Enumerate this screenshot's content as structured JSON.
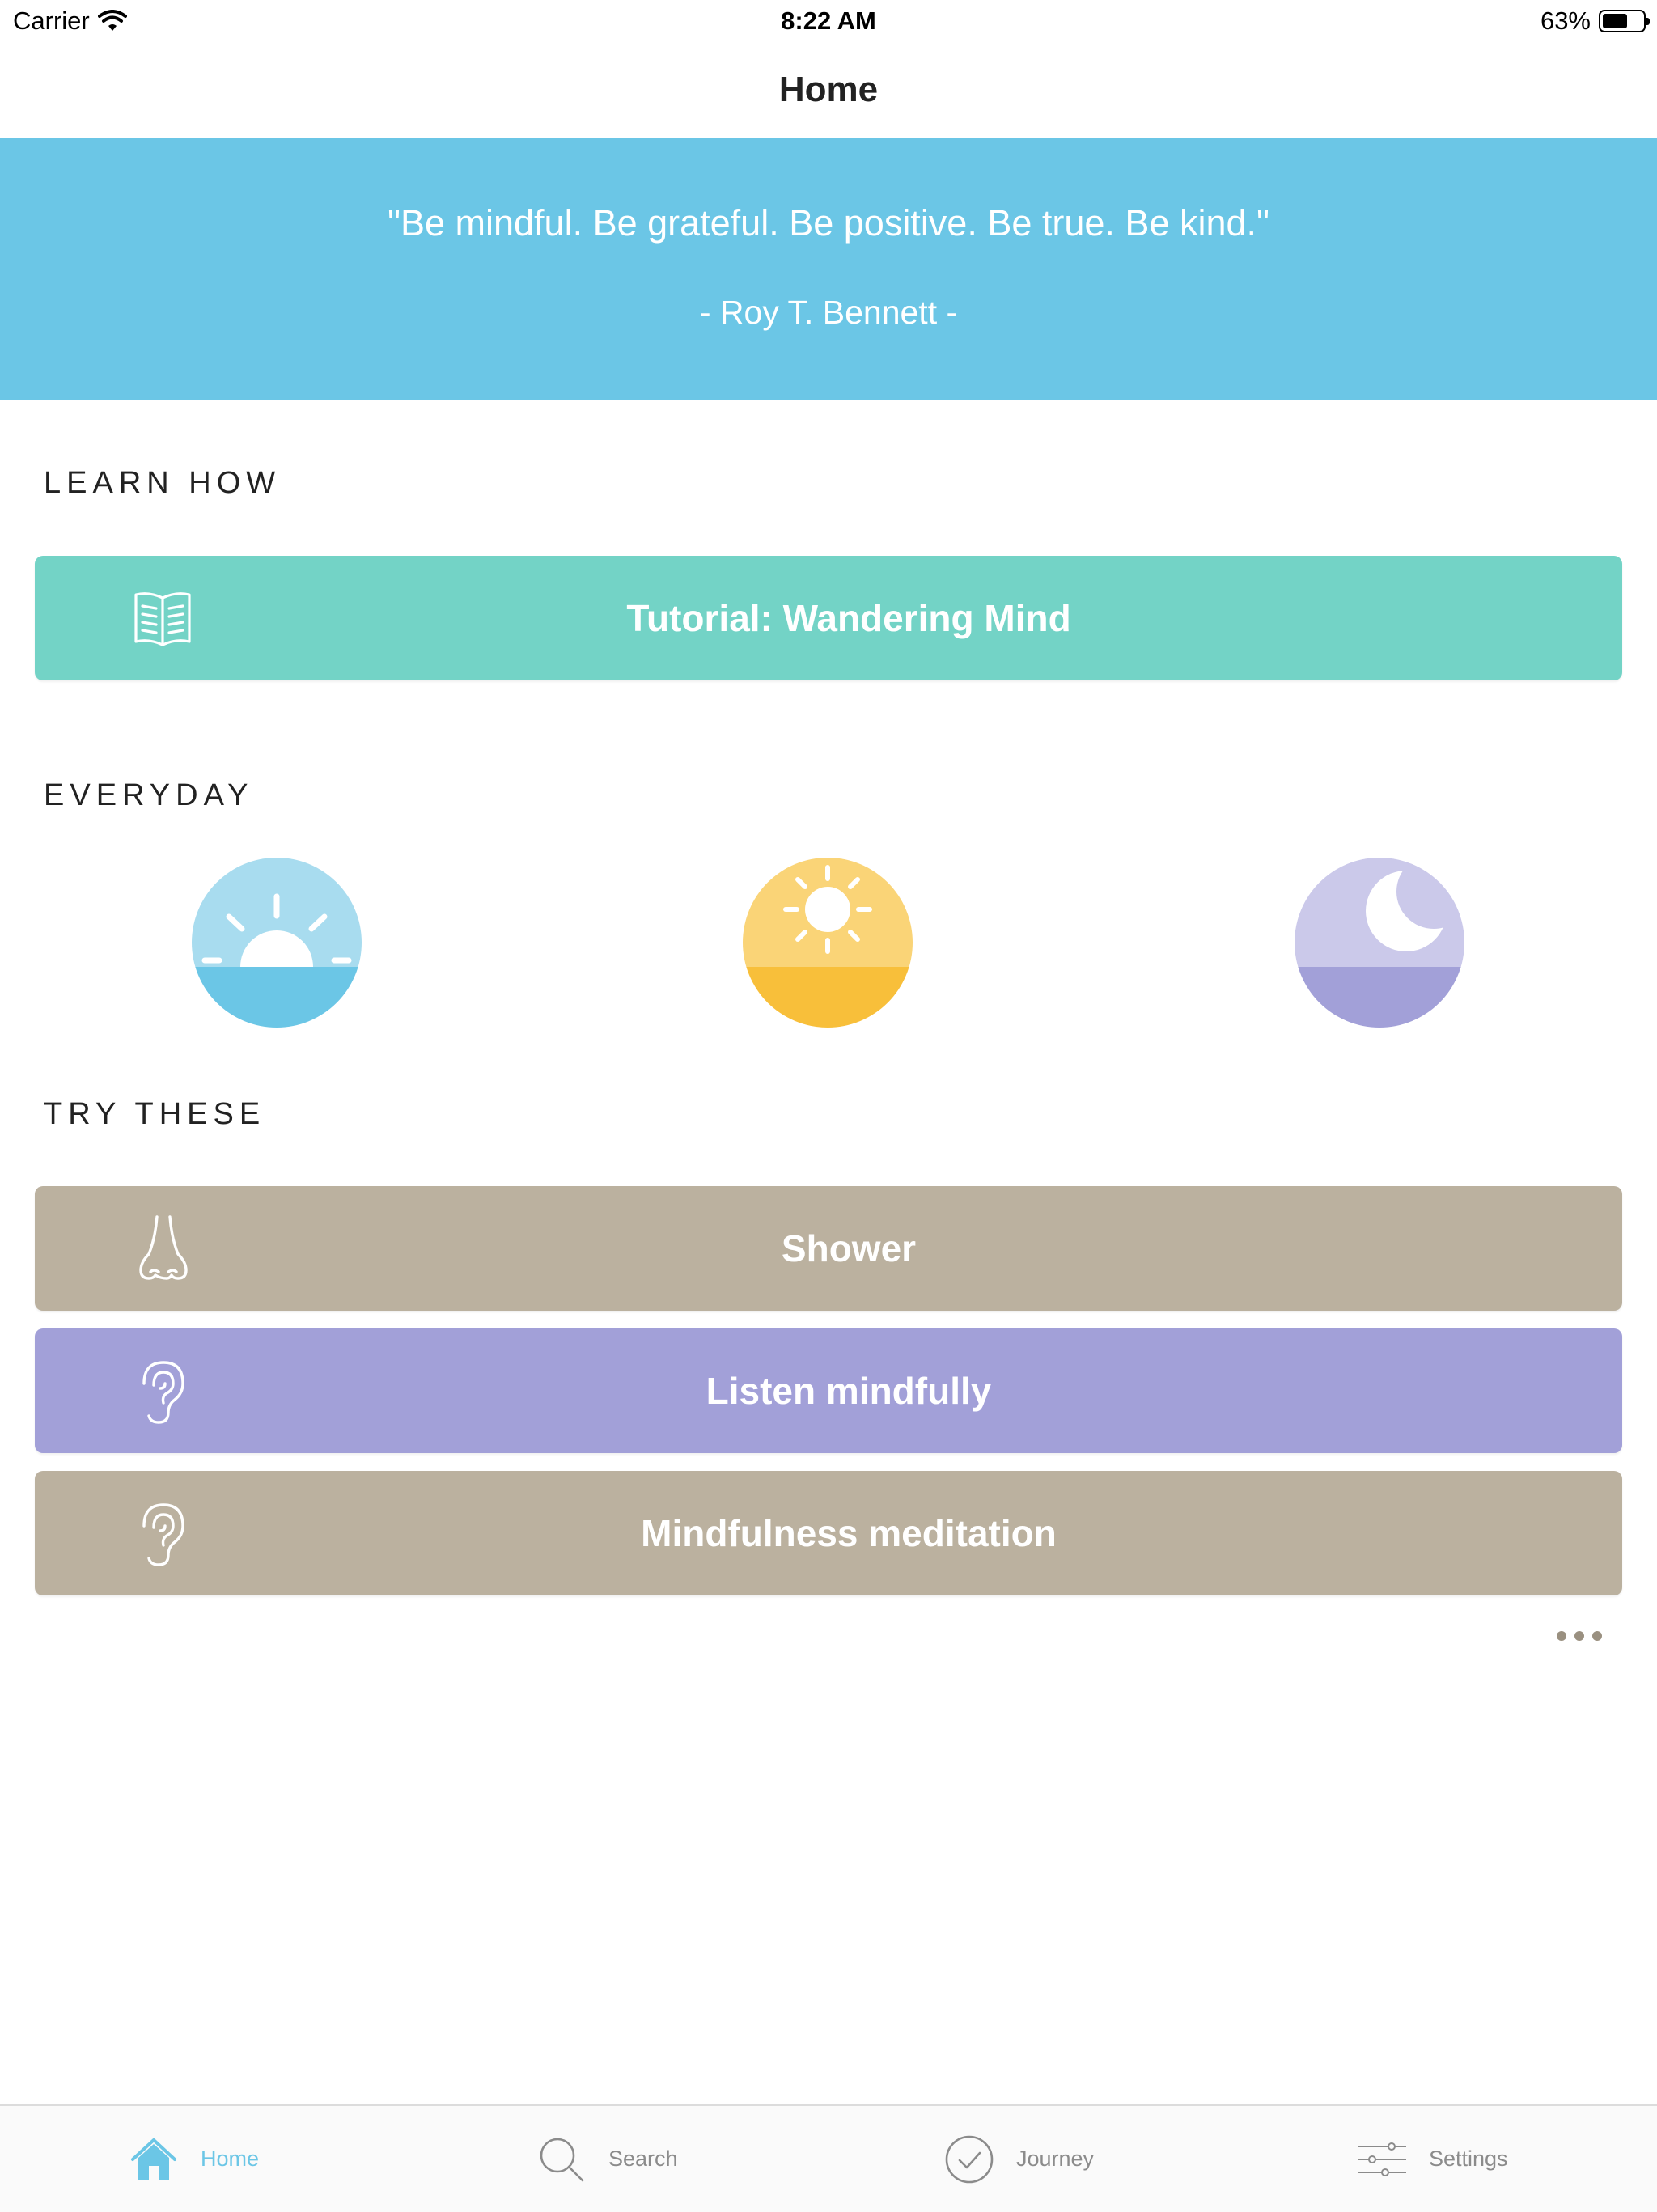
{
  "status_bar": {
    "carrier": "Carrier",
    "time": "8:22 AM",
    "battery_text": "63%",
    "battery_level": 0.63
  },
  "nav": {
    "title": "Home"
  },
  "quote": {
    "text": "\"Be mindful. Be grateful. Be positive. Be true. Be kind.\"",
    "author": "- Roy T. Bennett -",
    "bg_color": "#6bc6e6"
  },
  "learn_how": {
    "heading": "LEARN HOW",
    "tutorial": {
      "label": "Tutorial: Wandering Mind",
      "icon": "book-icon",
      "color": "#73d3c6"
    }
  },
  "everyday": {
    "heading": "EVERYDAY",
    "items": [
      {
        "icon": "sunrise-icon",
        "color_top": "#a8dcef",
        "color_bottom": "#6bc6e6"
      },
      {
        "icon": "sun-icon",
        "color_top": "#fad477",
        "color_bottom": "#f8bf3a"
      },
      {
        "icon": "moon-icon",
        "color_top": "#cbc9ea",
        "color_bottom": "#a2a0d8"
      }
    ]
  },
  "try_these": {
    "heading": "TRY THESE",
    "items": [
      {
        "label": "Shower",
        "icon": "nose-icon",
        "color": "#bbb19f"
      },
      {
        "label": "Listen mindfully",
        "icon": "ear-icon",
        "color": "#a2a0d8"
      },
      {
        "label": "Mindfulness meditation",
        "icon": "ear-icon",
        "color": "#bbb19f"
      }
    ],
    "more_icon": "more-dots-icon"
  },
  "tab_bar": {
    "tabs": [
      {
        "label": "Home",
        "icon": "home-icon",
        "active": true
      },
      {
        "label": "Search",
        "icon": "search-icon",
        "active": false
      },
      {
        "label": "Journey",
        "icon": "checkmark-circle-icon",
        "active": false
      },
      {
        "label": "Settings",
        "icon": "sliders-icon",
        "active": false
      }
    ],
    "active_color": "#6bc6e6"
  }
}
